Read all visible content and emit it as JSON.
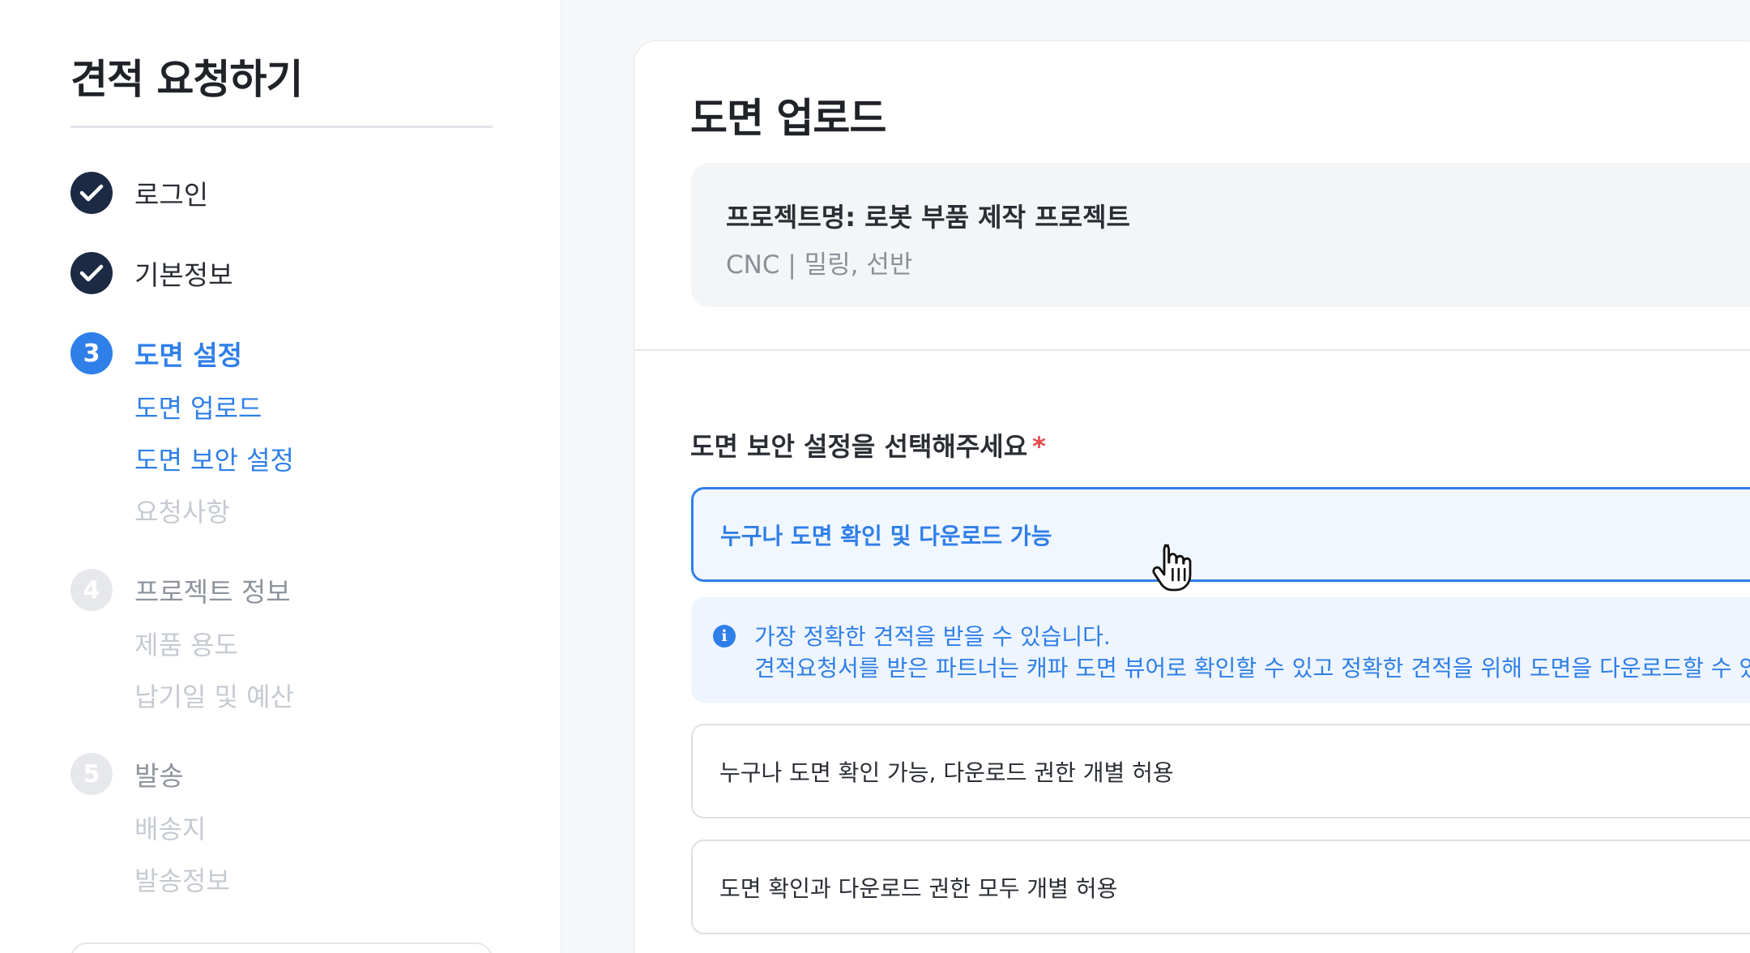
{
  "sidebar": {
    "title": "견적 요청하기",
    "steps": [
      {
        "badge": "✓",
        "label": "로그인",
        "state": "done"
      },
      {
        "badge": "✓",
        "label": "기본정보",
        "state": "done"
      },
      {
        "badge": "3",
        "label": "도면 설정",
        "state": "active",
        "substeps": [
          "도면 업로드",
          "도면 보안 설정",
          "요청사항"
        ]
      },
      {
        "badge": "4",
        "label": "프로젝트 정보",
        "state": "todo",
        "substeps": [
          "제품 용도",
          "납기일 및 예산"
        ]
      },
      {
        "badge": "5",
        "label": "발송",
        "state": "todo",
        "substeps": [
          "배송지",
          "발송정보"
        ]
      }
    ]
  },
  "main": {
    "title": "도면 업로드",
    "project": {
      "name": "프로젝트명: 로봇 부품 제작 프로젝트",
      "process": "CNC | 밀링, 선반"
    },
    "security": {
      "question": "도면 보안 설정을 선택해주세요",
      "required_mark": "*",
      "options": [
        "누구나 도면 확인 및 다운로드 가능",
        "누구나 도면 확인 가능, 다운로드 권한 개별 허용",
        "도면 확인과 다운로드 권한 모두 개별 허용"
      ],
      "selected_index": 0,
      "info": {
        "icon": "info-icon",
        "line1": "가장 정확한 견적을 받을 수 있습니다.",
        "line2": "견적요청서를 받은 파트너는 캐파 도면 뷰어로 확인할 수 있고 정확한 견적을 위해 도면을 다운로드할 수 있습"
      }
    }
  },
  "colors": {
    "accent": "#2f7fe8",
    "done_badge": "#1c2a44",
    "todo_badge": "#e6e8eb",
    "required": "#e5484d"
  }
}
